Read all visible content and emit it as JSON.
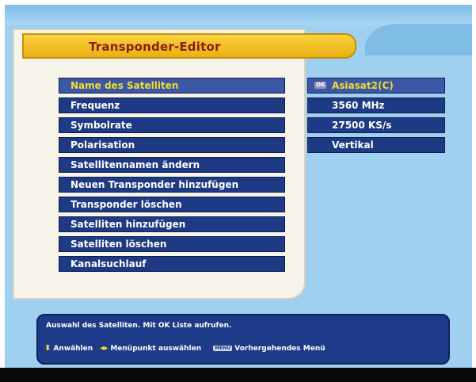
{
  "title": "Transponder-Editor",
  "menu": {
    "items": [
      "Name des Satelliten",
      "Frequenz",
      "Symbolrate",
      "Polarisation",
      "Satellitennamen ändern",
      "Neuen Transponder hinzufügen",
      "Transponder löschen",
      "Satelliten hinzufügen",
      "Satelliten löschen",
      "Kanalsuchlauf"
    ],
    "selected_index": 0
  },
  "values": {
    "ok_badge": "OK",
    "satellite": "Asiasat2(C)",
    "frequency": "3560 MHz",
    "symbolrate": "27500 KS/s",
    "polarisation": "Vertikal"
  },
  "help": {
    "text": "Auswahl des Satelliten. Mit OK Liste aufrufen.",
    "select_label": "Anwählen",
    "menu_item_label": "Menüpunkt auswählen",
    "menu_button": "MENU",
    "back_label": "Vorhergehendes Menü"
  },
  "icons": {
    "up_down": "up-down-arrows-icon",
    "left_right": "left-right-arrows-icon",
    "menu": "menu-button-icon"
  },
  "colors": {
    "background": "#9fd0f0",
    "panel": "#f7f4ea",
    "title_bar": "#f2c52a",
    "title_text": "#8a1d0c",
    "menu_item": "#1f3a85",
    "selected_text": "#f3df2c"
  }
}
